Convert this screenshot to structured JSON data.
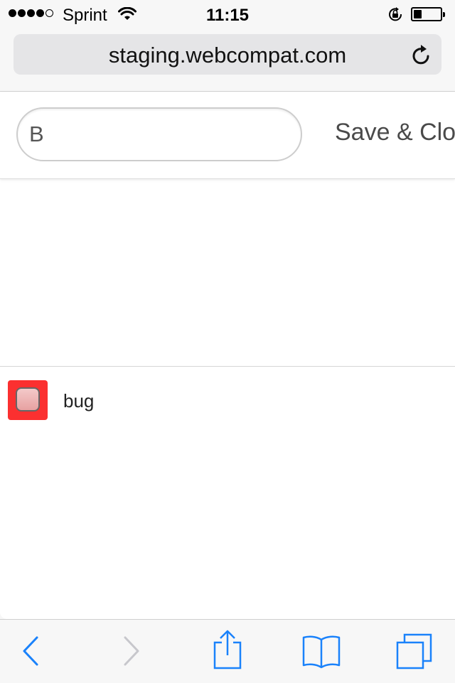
{
  "status_bar": {
    "carrier": "Sprint",
    "time": "11:15",
    "signal_bars_filled": 4,
    "signal_bars_total": 5,
    "battery_level": 0.3,
    "icons": [
      "wifi-icon",
      "rotation-lock-icon",
      "battery-icon"
    ]
  },
  "url_bar": {
    "url": "staging.webcompat.com",
    "reload_icon": "reload-icon"
  },
  "form": {
    "input_value": "B",
    "save_label": "Save & Clo"
  },
  "labels": [
    {
      "name": "bug",
      "color": "#fb3030"
    }
  ],
  "toolbar": {
    "items": [
      "back-icon",
      "forward-icon",
      "share-icon",
      "bookmarks-icon",
      "tabs-icon"
    ],
    "accent_color": "#1a82fb",
    "disabled_color": "#c7c7cc"
  }
}
